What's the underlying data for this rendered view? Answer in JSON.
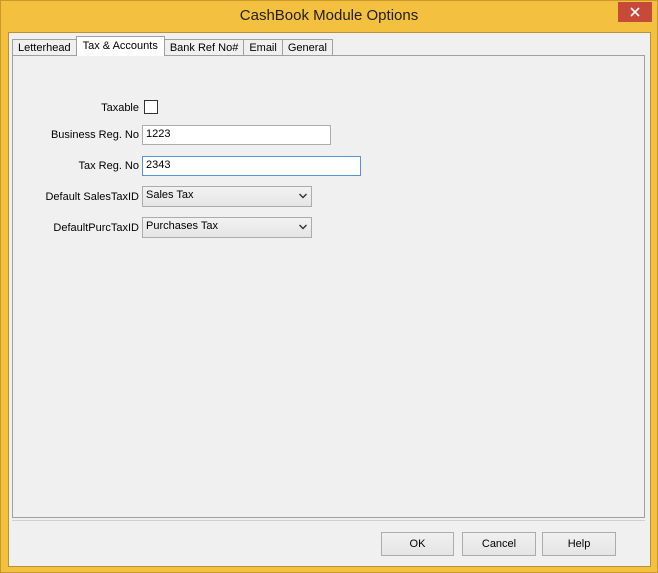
{
  "window": {
    "title": "CashBook Module Options"
  },
  "tabs": [
    {
      "label": "Letterhead"
    },
    {
      "label": "Tax & Accounts"
    },
    {
      "label": "Bank Ref No#"
    },
    {
      "label": "Email"
    },
    {
      "label": "General"
    }
  ],
  "form": {
    "taxable_label": "Taxable",
    "taxable_checked": false,
    "business_reg_label": "Business Reg. No",
    "business_reg_value": "1223",
    "tax_reg_label": "Tax Reg. No",
    "tax_reg_value": "2343",
    "default_sales_label": "Default SalesTaxID",
    "default_sales_value": "Sales Tax",
    "default_purc_label": "DefaultPurcTaxID",
    "default_purc_value": "Purchases Tax"
  },
  "buttons": {
    "ok": "OK",
    "cancel": "Cancel",
    "help": "Help"
  },
  "icons": {
    "close": "close-icon",
    "dropdown": "chevron-down-icon"
  },
  "colors": {
    "titlebar": "#f3c13f",
    "close_button": "#c7493a",
    "focus_border": "#5694d6"
  }
}
